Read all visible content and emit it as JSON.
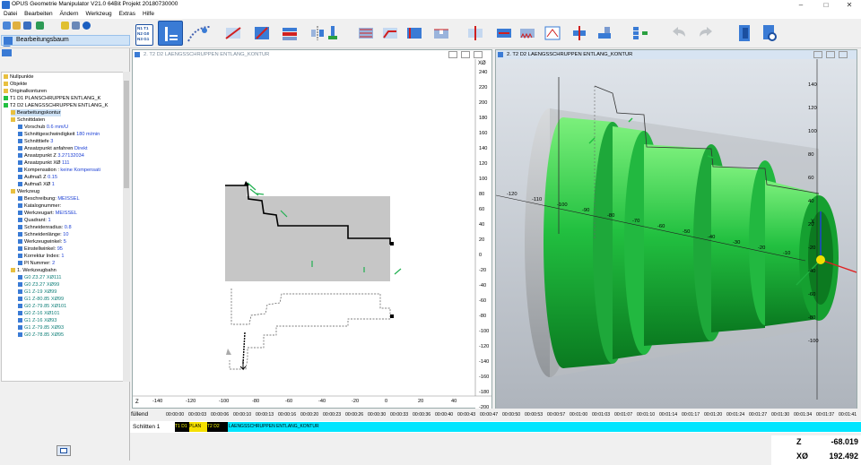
{
  "titlebar": {
    "title": "OPUS Geometrie Manipulator V21.0 64Bit   Projekt 20180730000",
    "minimize": "–",
    "maximize": "□",
    "close": "✕"
  },
  "menu": [
    "Datei",
    "Bearbeiten",
    "Ändern",
    "Werkzeug",
    "Extras",
    "Hilfe"
  ],
  "toolbar": {
    "nc_icon_lines": [
      "N1 T1",
      "N2 G0",
      "N3 G1"
    ]
  },
  "left_panel": {
    "header": "Bearbeitungsbaum"
  },
  "tree": [
    {
      "label": "Nullpunkte"
    },
    {
      "label": "Objekte"
    },
    {
      "label": "Originalkonturen"
    },
    {
      "label": "T1 D1 PLANSCHRUPPEN ENTLANG_K"
    },
    {
      "label": "T2 D2 LAENGSSCHRUPPEN ENTLANG_K"
    },
    {
      "label": "Bearbeitungskontur"
    },
    {
      "label": "Schnittdaten"
    },
    {
      "label": "Vorschub",
      "value": "0.6 mm/U"
    },
    {
      "label": "Schnittgeschwindigkeit",
      "value": "180 m/min"
    },
    {
      "label": "Schnitttiefe",
      "value": "3"
    },
    {
      "label": "Ansatzpunkt anfahren",
      "value": "Direkt"
    },
    {
      "label": "Ansatzpunkt Z",
      "value": "3.27132034"
    },
    {
      "label": "Ansatzpunkt XØ",
      "value": "111"
    },
    {
      "label": "Kompensation :",
      "value": "keine Kompensati"
    },
    {
      "label": "Aufmaß Z",
      "value": "0.15"
    },
    {
      "label": "Aufmaß XØ",
      "value": "1"
    },
    {
      "label": "Werkzeug"
    },
    {
      "label": "Beschreibung:",
      "value": "MEISSEL"
    },
    {
      "label": "Katalognummer:",
      "value": ""
    },
    {
      "label": "Werkzeugart:",
      "value": "MEISSEL"
    },
    {
      "label": "Quadrant:",
      "value": "1"
    },
    {
      "label": "Schneidenradius:",
      "value": "0.8"
    },
    {
      "label": "Schneidenlänge:",
      "value": "10"
    },
    {
      "label": "Werkzeugwinkel:",
      "value": "5"
    },
    {
      "label": "Einstellwinkel:",
      "value": "95"
    },
    {
      "label": "Korrektur Index:",
      "value": "1"
    },
    {
      "label": "Pl Nummer:",
      "value": "2"
    },
    {
      "label": "1. Werkzeugbahn"
    },
    {
      "label": "G0  Z3.27",
      "value": "XØ111"
    },
    {
      "label": "G0  Z3.27",
      "value": "XØ99"
    },
    {
      "label": "G1  Z-19",
      "value": "XØ99"
    },
    {
      "label": "G1  Z-80.85",
      "value": "XØ99"
    },
    {
      "label": "G0  Z-79.85",
      "value": "XØ101"
    },
    {
      "label": "G0  Z-16",
      "value": "XØ101"
    },
    {
      "label": "G1  Z-16",
      "value": "XØ93"
    },
    {
      "label": "G1  Z-79.85",
      "value": "XØ93"
    },
    {
      "label": "G0  Z-78.85",
      "value": "XØ95"
    }
  ],
  "pane1": {
    "title": "2. T2 D2 LAENGSSCHRUPPEN ENTLANG_KONTUR",
    "x_axis_label": "Z",
    "y_axis_label": "XØ",
    "x_ticks": [
      "-140",
      "-120",
      "-100",
      "-80",
      "-60",
      "-40",
      "-20",
      "0",
      "20",
      "40"
    ],
    "y_ticks": [
      "240",
      "220",
      "200",
      "180",
      "160",
      "140",
      "120",
      "100",
      "80",
      "60",
      "40",
      "20",
      "0",
      "-20",
      "-40",
      "-60",
      "-80",
      "-100",
      "-120",
      "-140",
      "-160",
      "-180",
      "-200"
    ]
  },
  "pane2": {
    "title": "2. T2 D2 LAENGSSCHRUPPEN ENTLANG_KONTUR",
    "x_ticks": [
      "-120",
      "-110",
      "-100",
      "-90",
      "-80",
      "-70",
      "-60",
      "-50",
      "-40",
      "-30",
      "-20",
      "-10"
    ],
    "y_ticks": [
      "140",
      "120",
      "100",
      "80",
      "60",
      "40",
      "20",
      "-20",
      "-40",
      "-60",
      "-80",
      "-100"
    ],
    "axis_x": "X",
    "axis_z": "Z"
  },
  "timeline": {
    "label": "füllend",
    "ticks": [
      "00:00:00",
      "00:00:03",
      "00:00:06",
      "00:00:10",
      "00:00:13",
      "00:00:16",
      "00:00:20",
      "00:00:23",
      "00:00:26",
      "00:00:30",
      "00:00:33",
      "00:00:36",
      "00:00:40",
      "00:00:43",
      "00:00:47",
      "00:00:50",
      "00:00:53",
      "00:00:57",
      "00:01:00",
      "00:01:03",
      "00:01:07",
      "00:01:10",
      "00:01:14",
      "00:01:17",
      "00:01:20",
      "00:01:24",
      "00:01:27",
      "00:01:30",
      "00:01:34",
      "00:01:37",
      "00:01:41"
    ]
  },
  "track": {
    "label": "Schlitten 1",
    "seg1": "T1 D1",
    "seg2": "PLAN",
    "seg3": "T2 D2 ",
    "seg4": "LAENGSSCHRUPPEN ENTLANG_KONTUR"
  },
  "readout": {
    "z_label": "Z",
    "z_value": "-68.019",
    "x_label": "XØ",
    "x_value": "192.492"
  },
  "colors": {
    "accent": "#3a7bd5",
    "part_green": "#22c040",
    "track_cyan": "#00e5ff",
    "seg_yellow": "#f5e000"
  }
}
